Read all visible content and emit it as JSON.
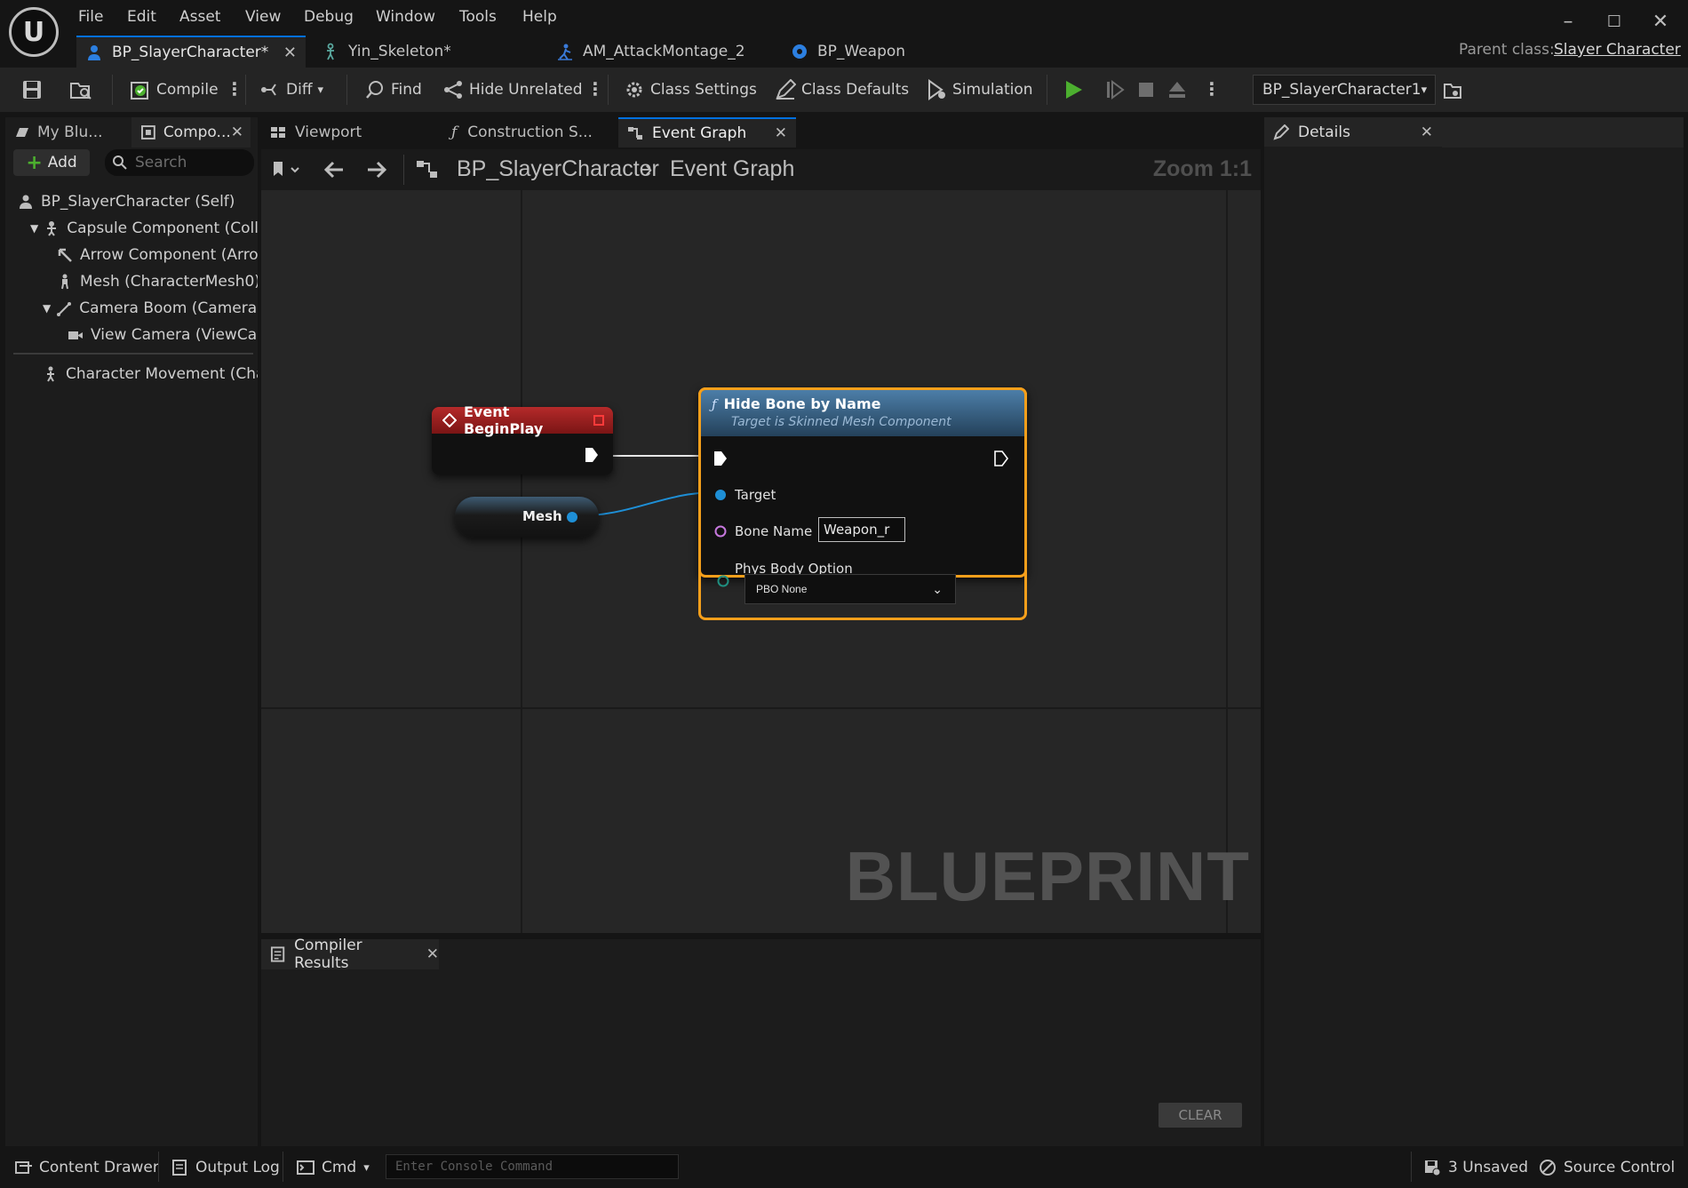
{
  "menu": [
    "File",
    "Edit",
    "Asset",
    "View",
    "Debug",
    "Window",
    "Tools",
    "Help"
  ],
  "doc_tabs": [
    {
      "label": "BP_SlayerCharacter*",
      "icon": "blueprint-character-icon"
    },
    {
      "label": "Yin_Skeleton*",
      "icon": "skeleton-icon"
    },
    {
      "label": "AM_AttackMontage_2",
      "icon": "anim-montage-icon"
    },
    {
      "label": "BP_Weapon",
      "icon": "blueprint-icon"
    }
  ],
  "parent_class": {
    "label": "Parent class:",
    "value": "Slayer Character"
  },
  "toolbar": {
    "compile": "Compile",
    "diff": "Diff",
    "find": "Find",
    "hide_unrelated": "Hide Unrelated",
    "class_settings": "Class Settings",
    "class_defaults": "Class Defaults",
    "simulation": "Simulation",
    "debug_object": "BP_SlayerCharacter1"
  },
  "left_tabs": [
    "My Blu...",
    "Compo..."
  ],
  "components": {
    "add_label": "Add",
    "search_placeholder": "Search",
    "items": [
      "BP_SlayerCharacter (Self)",
      "Capsule Component (CollisionCylinder)",
      "Arrow Component (Arrow)",
      "Mesh (CharacterMesh0)",
      "Camera Boom (CameraBoom)",
      "View Camera (ViewCamera)",
      "Character Movement (CharMoveComp)"
    ]
  },
  "center_tabs": [
    "Viewport",
    "Construction S...",
    "Event Graph"
  ],
  "breadcrumb": {
    "root": "BP_SlayerCharacter",
    "leaf": "Event Graph"
  },
  "graph": {
    "zoom": "Zoom 1:1",
    "watermark": "BLUEPRINT",
    "event_node": "Event BeginPlay",
    "mesh_node": "Mesh",
    "function_node": {
      "title": "Hide Bone by Name",
      "subtitle": "Target is Skinned Mesh Component",
      "target_pin": "Target",
      "bone_name_label": "Bone Name",
      "bone_name_value": "Weapon_r",
      "phys_body_label": "Phys Body Option",
      "phys_body_value": "PBO None"
    }
  },
  "compiler": {
    "tab": "Compiler Results",
    "clear": "CLEAR"
  },
  "details": {
    "tab": "Details"
  },
  "status": {
    "content_drawer": "Content Drawer",
    "output_log": "Output Log",
    "cmd": "Cmd",
    "console_placeholder": "Enter Console Command",
    "unsaved": "3 Unsaved",
    "source_control": "Source Control"
  },
  "colors": {
    "accent": "#0070e0",
    "event_header": "#8a1c1c",
    "function_header": "#3c6e95",
    "selection": "#f59f1b",
    "exec_green": "#4caf2f"
  }
}
